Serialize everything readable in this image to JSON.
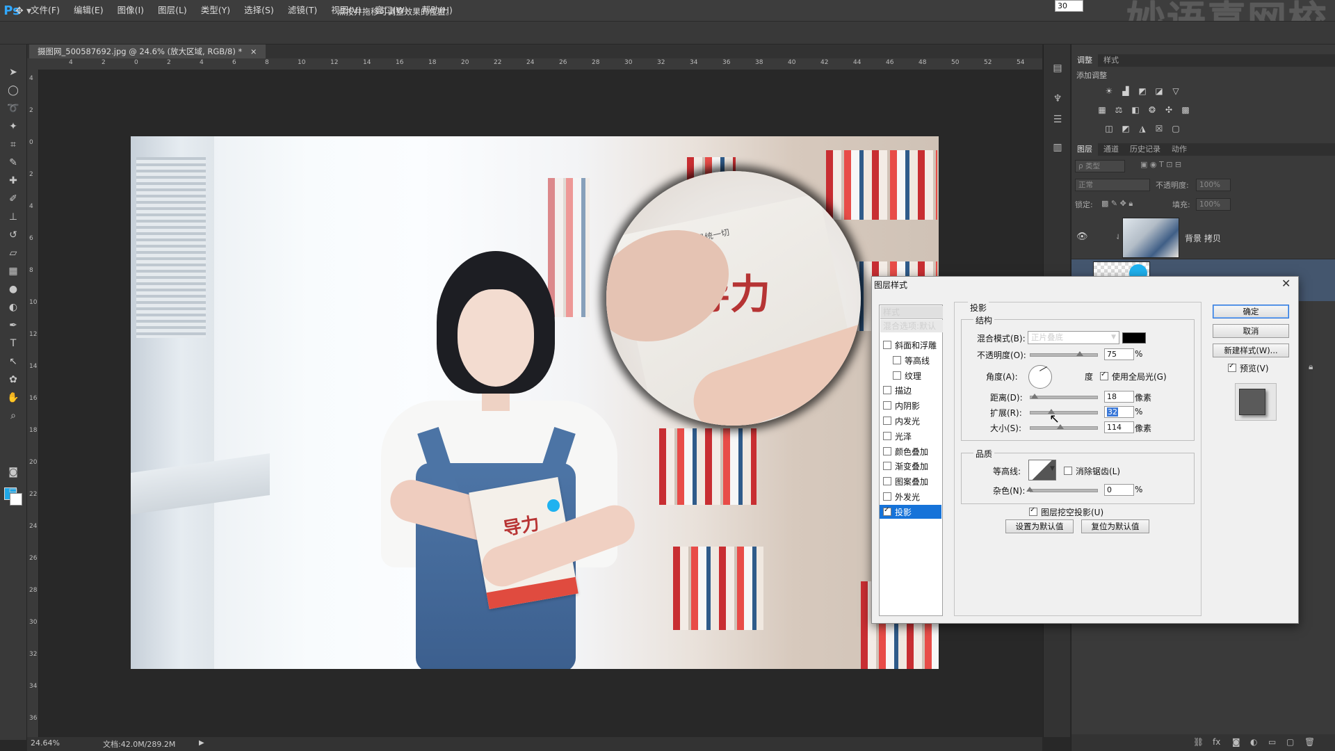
{
  "app": {
    "logo": "Ps",
    "watermark": "妙语喜网校"
  },
  "menu": [
    "文件(F)",
    "编辑(E)",
    "图像(I)",
    "图层(L)",
    "类型(Y)",
    "选择(S)",
    "滤镜(T)",
    "视图(V)",
    "窗口(W)",
    "帮助(H)"
  ],
  "options_bar": {
    "hint": "点按并拖移可调整效果的位置。"
  },
  "document": {
    "tab_title": "摄图网_500587692.jpg @ 24.6% (放大区域, RGB/8) *",
    "tab_close": "×",
    "ruler_h": [
      "4",
      "2",
      "0",
      "2",
      "4",
      "6",
      "8",
      "10",
      "12",
      "14",
      "16",
      "18",
      "20",
      "22",
      "24",
      "26",
      "28",
      "30",
      "32",
      "34",
      "36",
      "38",
      "40",
      "42",
      "44",
      "46",
      "48",
      "50",
      "52",
      "54"
    ],
    "ruler_v": [
      "4",
      "2",
      "0",
      "2",
      "4",
      "6",
      "8",
      "10",
      "12",
      "14",
      "16",
      "18",
      "20",
      "22",
      "24",
      "26",
      "28",
      "30",
      "32",
      "34",
      "36"
    ],
    "book_text": "导力",
    "magnified_text": "导力",
    "magnified_subtext": "情感的力量是统一切"
  },
  "status": {
    "zoom": "24.64%",
    "doc_size": "文档:42.0M/289.2M"
  },
  "panels": {
    "top_tabs": [
      "调整",
      "样式"
    ],
    "add_adjustment": "添加调整",
    "layer_tabs": [
      "图层",
      "通道",
      "历史记录",
      "动作"
    ],
    "filter_kind": "ρ 类型",
    "blend_mode": "正常",
    "opacity_label": "不透明度:",
    "opacity_value": "100%",
    "lock_label": "锁定:",
    "fill_label": "填充:",
    "fill_value": "100%",
    "layers": [
      {
        "name": "背景 拷贝"
      },
      {
        "name": ""
      }
    ]
  },
  "dialog": {
    "title": "图层样式",
    "close": "✕",
    "styles_header": "样式",
    "blend_default": "混合选项:默认",
    "style_items": [
      {
        "label": "斜面和浮雕",
        "checked": false,
        "indent": false
      },
      {
        "label": "等高线",
        "checked": false,
        "indent": true
      },
      {
        "label": "纹理",
        "checked": false,
        "indent": true
      },
      {
        "label": "描边",
        "checked": false,
        "indent": false
      },
      {
        "label": "内阴影",
        "checked": false,
        "indent": false
      },
      {
        "label": "内发光",
        "checked": false,
        "indent": false
      },
      {
        "label": "光泽",
        "checked": false,
        "indent": false
      },
      {
        "label": "颜色叠加",
        "checked": false,
        "indent": false
      },
      {
        "label": "渐变叠加",
        "checked": false,
        "indent": false
      },
      {
        "label": "图案叠加",
        "checked": false,
        "indent": false
      },
      {
        "label": "外发光",
        "checked": false,
        "indent": false
      },
      {
        "label": "投影",
        "checked": true,
        "indent": false,
        "selected": true
      }
    ],
    "section_title": "投影",
    "structure": {
      "title": "结构",
      "blend_mode_label": "混合模式(B):",
      "blend_mode_value": "正片叠底",
      "shadow_color": "#000000",
      "opacity_label": "不透明度(O):",
      "opacity_value": "75",
      "angle_label": "角度(A):",
      "angle_value": "30",
      "angle_unit": "度",
      "global_light_label": "使用全局光(G)",
      "distance_label": "距离(D):",
      "distance_value": "18",
      "spread_label": "扩展(R):",
      "spread_value": "32",
      "size_label": "大小(S):",
      "size_value": "114",
      "unit_px": "像素",
      "unit_pct": "%"
    },
    "quality": {
      "title": "品质",
      "contour_label": "等高线:",
      "antialias_label": "消除锯齿(L)",
      "noise_label": "杂色(N):",
      "noise_value": "0"
    },
    "knockout_label": "图层挖空投影(U)",
    "make_default": "设置为默认值",
    "reset_default": "复位为默认值",
    "buttons": {
      "ok": "确定",
      "cancel": "取消",
      "new_style": "新建样式(W)...",
      "preview": "预览(V)"
    }
  }
}
